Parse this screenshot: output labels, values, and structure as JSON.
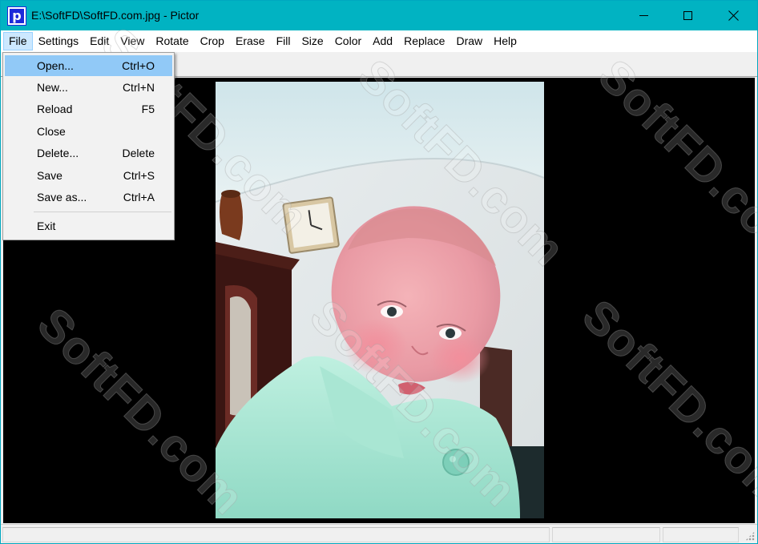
{
  "window": {
    "title": "E:\\SoftFD\\SoftFD.com.jpg - Pictor",
    "app_icon_letter": "p"
  },
  "menubar": {
    "items": [
      "File",
      "Settings",
      "Edit",
      "View",
      "Rotate",
      "Crop",
      "Erase",
      "Fill",
      "Size",
      "Color",
      "Add",
      "Replace",
      "Draw",
      "Help"
    ],
    "active_item": "File"
  },
  "file_menu": {
    "items": [
      {
        "label": "Open...",
        "shortcut": "Ctrl+O"
      },
      {
        "label": "New...",
        "shortcut": "Ctrl+N"
      },
      {
        "label": "Reload",
        "shortcut": "F5"
      },
      {
        "label": "Close",
        "shortcut": ""
      },
      {
        "label": "Delete...",
        "shortcut": "Delete"
      },
      {
        "label": "Save",
        "shortcut": "Ctrl+S"
      },
      {
        "label": "Save as...",
        "shortcut": "Ctrl+A"
      },
      {
        "label": "Exit",
        "shortcut": ""
      }
    ],
    "highlighted_item": "Open..."
  },
  "watermark": {
    "text": "SoftFD.com"
  },
  "colors": {
    "titlebar": "#01b3c2",
    "menu_highlight": "#91c9f7",
    "canvas_background": "#000000"
  },
  "icons": {
    "app": "pictor-app-icon",
    "minimize": "minimize-icon",
    "maximize": "maximize-icon",
    "close": "close-icon"
  }
}
